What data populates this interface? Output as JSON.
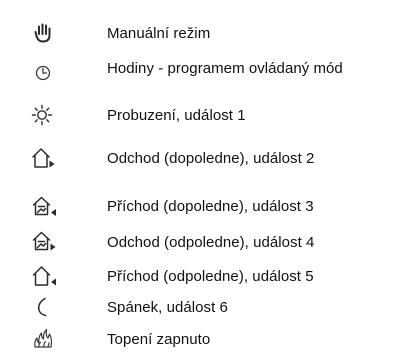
{
  "legend": {
    "items": [
      {
        "icon": "hand-icon",
        "label": "Manuální režim"
      },
      {
        "icon": "clock-icon",
        "label": "Hodiny - programem ovládaný mód"
      },
      {
        "icon": "sun-icon",
        "label": "Probuzení, událost 1"
      },
      {
        "icon": "house-leave-icon",
        "label": "Odchod (dopoledne), událost 2"
      },
      {
        "icon": "house-arrive-icon",
        "label": "Příchod (dopoledne), událost 3"
      },
      {
        "icon": "house-leave-icon",
        "label": "Odchod (odpoledne), událost 4"
      },
      {
        "icon": "house-arrive-icon",
        "label": "Příchod (odpoledne), událost 5"
      },
      {
        "icon": "moon-icon",
        "label": "Spánek, událost 6"
      },
      {
        "icon": "flame-icon",
        "label": "Topení zapnuto"
      }
    ]
  },
  "colors": {
    "icon_stroke": "#2b2b2b",
    "text": "#111111",
    "background": "#ffffff"
  }
}
